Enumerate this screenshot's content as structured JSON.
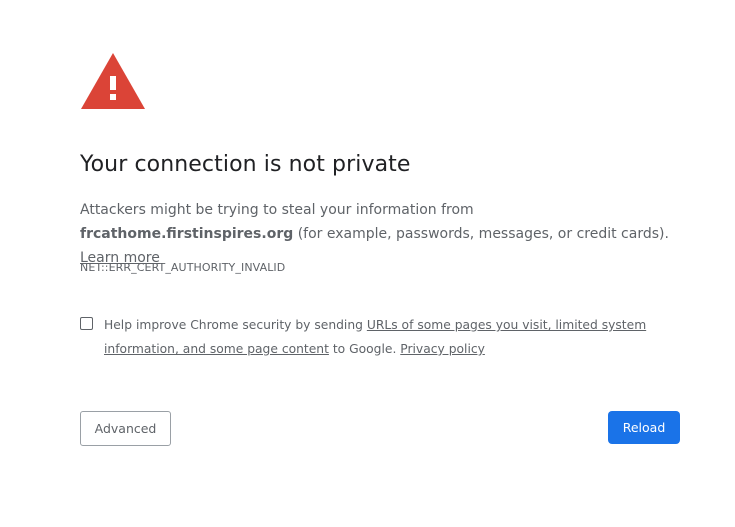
{
  "icon": {
    "name": "warning-triangle-icon",
    "color": "#db4437"
  },
  "title": "Your connection is not private",
  "description": {
    "before": "Attackers might be trying to steal your information from ",
    "host": "frcathome.firstinspires.org",
    "after": " (for example, passwords, messages, or credit cards). ",
    "learn_more": "Learn more"
  },
  "error_code": "NET::ERR_CERT_AUTHORITY_INVALID",
  "optin": {
    "checked": false,
    "before": "Help improve Chrome security by sending ",
    "link_text": "URLs of some pages you visit, limited system information, and some page content",
    "middle": " to Google. ",
    "privacy_link": "Privacy policy"
  },
  "buttons": {
    "advanced": "Advanced",
    "reload": "Reload"
  },
  "colors": {
    "primary_button": "#1a73e8",
    "text": "#5f6368",
    "title": "#202124"
  }
}
